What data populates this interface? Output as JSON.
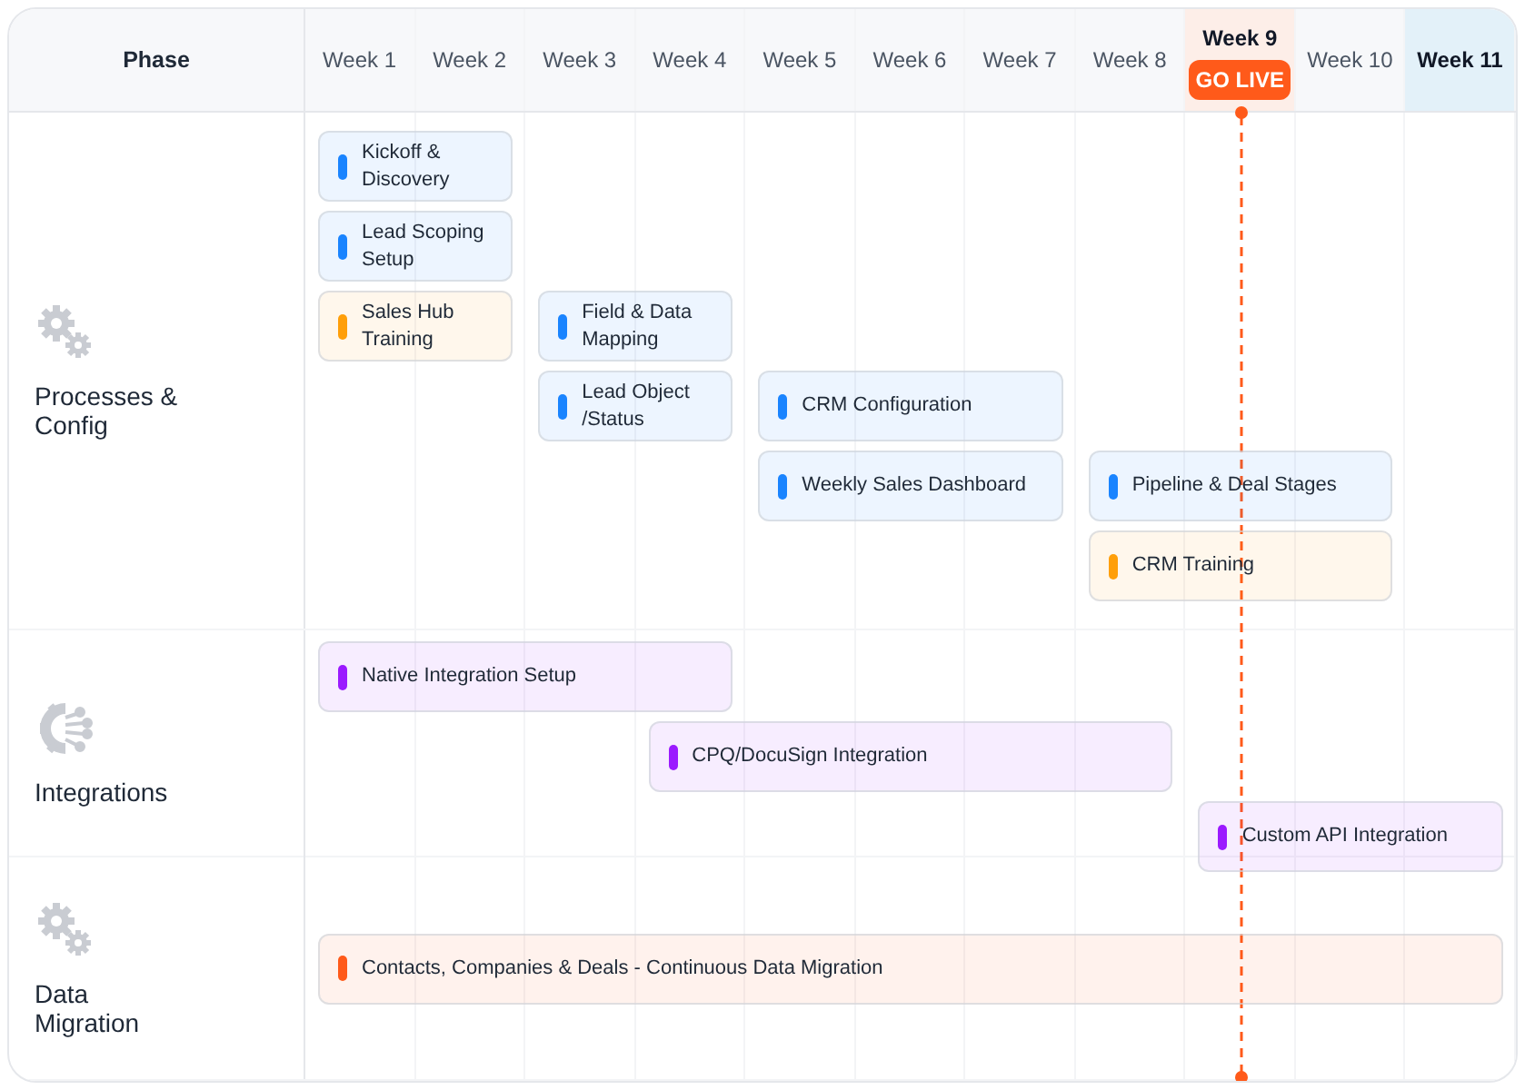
{
  "header": {
    "phase_label": "Phase",
    "weeks": [
      {
        "label": "Week 1",
        "selected": false
      },
      {
        "label": "Week 2",
        "selected": false
      },
      {
        "label": "Week 3",
        "selected": false
      },
      {
        "label": "Week 4",
        "selected": false
      },
      {
        "label": "Week 5",
        "selected": false
      },
      {
        "label": "Week 6",
        "selected": false
      },
      {
        "label": "Week 7",
        "selected": false
      },
      {
        "label": "Week 8",
        "selected": false
      },
      {
        "label": "Week 9",
        "selected": false,
        "milestone": "GO LIVE"
      },
      {
        "label": "Week 10",
        "selected": false
      },
      {
        "label": "Week 11",
        "selected": true
      }
    ]
  },
  "phases": [
    {
      "label": "Processes & Config",
      "lanes": [
        [
          {
            "label": "Kickoff & Discovery",
            "color": "#1a84ff"
          }
        ],
        [
          {
            "label": "Lead Scoping Setup",
            "color": "#1a84ff"
          }
        ],
        [
          {
            "label": "Sales Hub Training",
            "color": "#ff9f0a"
          },
          {
            "label": "Field & Data Mapping",
            "color": "#1a84ff"
          }
        ],
        [
          {
            "label": "Lead Object /Status",
            "color": "#1a84ff"
          },
          {
            "label": "CRM Configuration",
            "color": "#1a84ff"
          }
        ],
        [
          {
            "label": "Weekly Sales Dashboard",
            "color": "#1a84ff"
          },
          {
            "label": "Pipeline & Deal Stages",
            "color": "#1a84ff"
          }
        ],
        [
          {
            "label": "CRM Training",
            "color": "#ff9f0a"
          }
        ]
      ]
    },
    {
      "label": "Integrations",
      "lanes": [
        [
          {
            "label": "Native Integration Setup",
            "color": "#9b1aff"
          }
        ],
        [
          {
            "label": "CPQ/DocuSign Integration",
            "color": "#9b1aff"
          }
        ],
        [
          {
            "label": "Custom API Integration",
            "color": "#9b1aff"
          }
        ]
      ]
    },
    {
      "label": "Data Migration",
      "lanes": [
        [
          {
            "label": "Contacts, Companies & Deals - Continuous Data Migration",
            "color": "#ff5a1a"
          }
        ]
      ]
    }
  ]
}
